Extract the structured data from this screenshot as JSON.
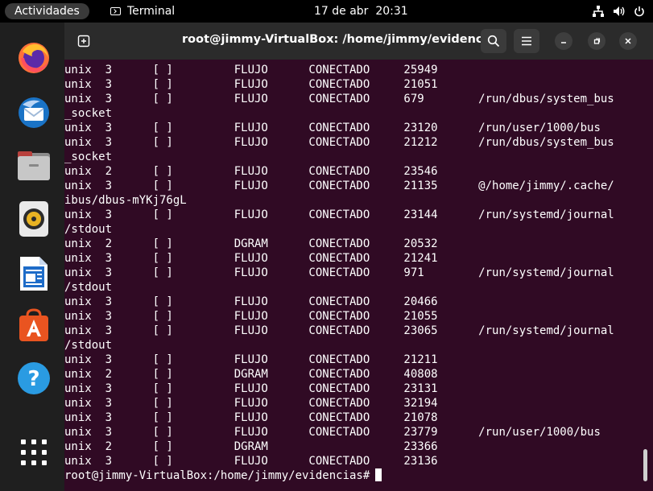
{
  "topbar": {
    "activities_label": "Actividades",
    "app_name": "Terminal",
    "clock": "17 de abr  20:31",
    "tray_icons": [
      "network-icon",
      "volume-icon",
      "power-icon"
    ]
  },
  "dock": {
    "apps": [
      {
        "name": "firefox-icon",
        "label": "Firefox"
      },
      {
        "name": "thunderbird-icon",
        "label": "Thunderbird"
      },
      {
        "name": "files-icon",
        "label": "Archivos"
      },
      {
        "name": "rhythmbox-icon",
        "label": "Rhythmbox"
      },
      {
        "name": "libreoffice-writer-icon",
        "label": "LibreOffice Writer"
      },
      {
        "name": "software-center-icon",
        "label": "Ubuntu Software"
      },
      {
        "name": "help-icon",
        "label": "Ayuda"
      },
      {
        "name": "show-apps-icon",
        "label": "Mostrar aplicaciones"
      }
    ]
  },
  "window": {
    "title": "root@jimmy-VirtualBox: /home/jimmy/evidencias",
    "buttons": [
      "new-tab-icon",
      "search-icon",
      "hamburger-menu-icon",
      "minimize-icon",
      "maximize-icon",
      "close-icon"
    ]
  },
  "terminal": {
    "lines": [
      "unix  3      [ ]         FLUJO      CONECTADO     25949",
      "unix  3      [ ]         FLUJO      CONECTADO     21051",
      "unix  3      [ ]         FLUJO      CONECTADO     679        /run/dbus/system_bus",
      "_socket",
      "unix  3      [ ]         FLUJO      CONECTADO     23120      /run/user/1000/bus",
      "unix  3      [ ]         FLUJO      CONECTADO     21212      /run/dbus/system_bus",
      "_socket",
      "unix  2      [ ]         FLUJO      CONECTADO     23546",
      "unix  3      [ ]         FLUJO      CONECTADO     21135      @/home/jimmy/.cache/",
      "ibus/dbus-mYKj76gL",
      "unix  3      [ ]         FLUJO      CONECTADO     23144      /run/systemd/journal",
      "/stdout",
      "unix  2      [ ]         DGRAM      CONECTADO     20532",
      "unix  3      [ ]         FLUJO      CONECTADO     21241",
      "unix  3      [ ]         FLUJO      CONECTADO     971        /run/systemd/journal",
      "/stdout",
      "unix  3      [ ]         FLUJO      CONECTADO     20466",
      "unix  3      [ ]         FLUJO      CONECTADO     21055",
      "unix  3      [ ]         FLUJO      CONECTADO     23065      /run/systemd/journal",
      "/stdout",
      "unix  3      [ ]         FLUJO      CONECTADO     21211",
      "unix  2      [ ]         DGRAM      CONECTADO     40808",
      "unix  3      [ ]         FLUJO      CONECTADO     23131",
      "unix  3      [ ]         FLUJO      CONECTADO     32194",
      "unix  3      [ ]         FLUJO      CONECTADO     21078",
      "unix  3      [ ]         FLUJO      CONECTADO     23779      /run/user/1000/bus",
      "unix  2      [ ]         DGRAM                    23366",
      "unix  3      [ ]         FLUJO      CONECTADO     23136"
    ],
    "prompt": "root@jimmy-VirtualBox:/home/jimmy/evidencias#",
    "colors": {
      "background": "#300a24",
      "foreground": "#ffffff"
    }
  }
}
